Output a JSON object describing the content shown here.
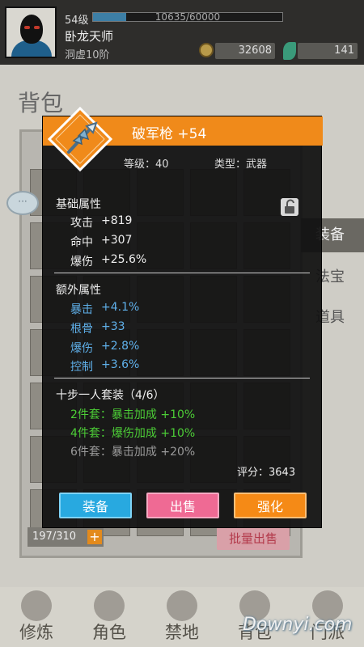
{
  "player": {
    "level": "54级",
    "xp_text": "10635/60000",
    "xp_fraction": 0.177,
    "name": "卧龙天师",
    "realm": "洞虚10阶",
    "coins": "32608",
    "jade": "141"
  },
  "bag": {
    "title": "背包",
    "count": "197/310",
    "count_plus": "+",
    "batch_sell": "批量出售",
    "side_tabs": [
      "装备",
      "法宝",
      "道具"
    ],
    "chat": "···"
  },
  "nav": [
    "修炼",
    "角色",
    "禁地",
    "背包",
    "门派"
  ],
  "watermark": "Downyi.com",
  "item": {
    "name": "破军枪 +54",
    "level": "等级：40",
    "type": "类型：武器",
    "base_title": "基础属性",
    "base": [
      {
        "label": "攻击",
        "value": "+819"
      },
      {
        "label": "命中",
        "value": "+307"
      },
      {
        "label": "爆伤",
        "value": "+25.6%"
      }
    ],
    "extra_title": "额外属性",
    "extra": [
      {
        "label": "暴击",
        "value": "+4.1%"
      },
      {
        "label": "根骨",
        "value": "+33"
      },
      {
        "label": "爆伤",
        "value": "+2.8%"
      },
      {
        "label": "控制",
        "value": "+3.6%"
      }
    ],
    "set_title": "十步一人套装（4/6）",
    "set_bonuses": [
      "2件套：暴击加成 +10%",
      "4件套：爆伤加成 +10%",
      "6件套：暴击加成 +20%"
    ],
    "score": "评分：3643"
  },
  "buttons": {
    "equip": "装备",
    "sell": "出售",
    "upgrade": "强化"
  },
  "colors": {
    "header": "#f08a1a",
    "extra_attr": "#5fb0ea",
    "set_active": "#4ccd36",
    "set_inactive": "#9a9a9a"
  },
  "icons": {
    "item": "spear-icon",
    "lock": "unlock-icon",
    "coin": "coin-icon",
    "jade": "jade-icon"
  }
}
